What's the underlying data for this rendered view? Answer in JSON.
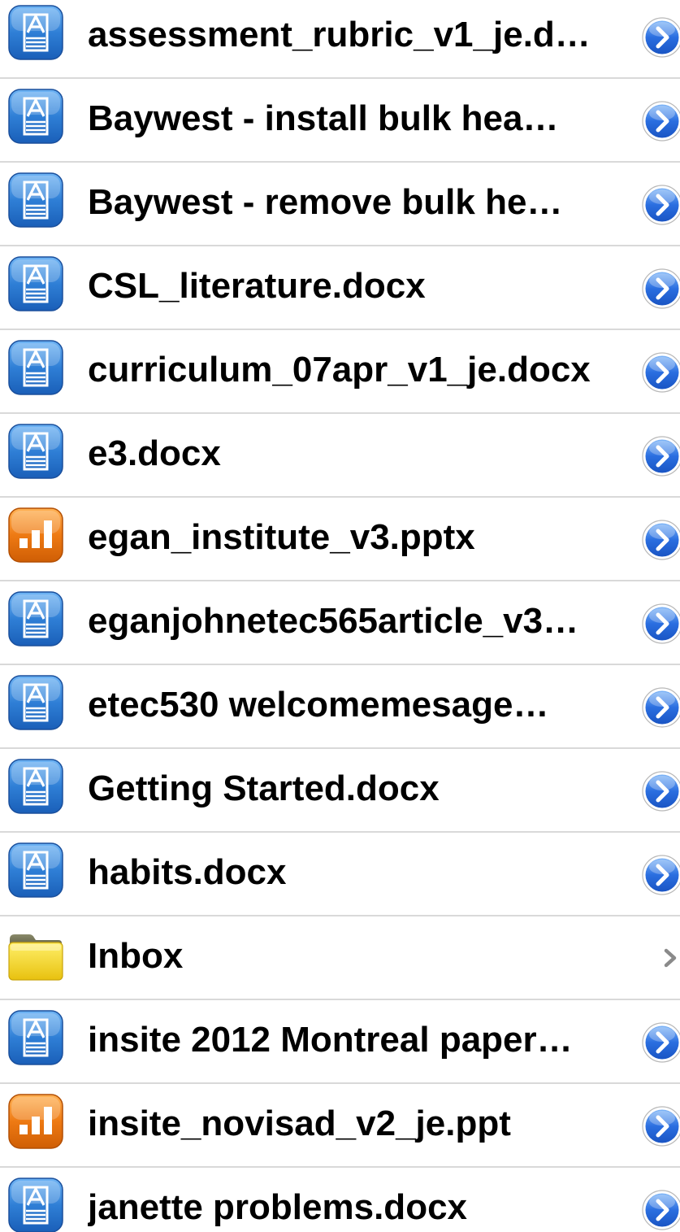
{
  "files": [
    {
      "name": "assessment_rubric_v1_je.d…",
      "type": "doc",
      "accessory": "detail"
    },
    {
      "name": "Baywest - install bulk hea…",
      "type": "doc",
      "accessory": "detail"
    },
    {
      "name": "Baywest - remove bulk he…",
      "type": "doc",
      "accessory": "detail"
    },
    {
      "name": "CSL_literature.docx",
      "type": "doc",
      "accessory": "detail"
    },
    {
      "name": "curriculum_07apr_v1_je.docx",
      "type": "doc",
      "accessory": "detail"
    },
    {
      "name": "e3.docx",
      "type": "doc",
      "accessory": "detail"
    },
    {
      "name": "egan_institute_v3.pptx",
      "type": "ppt",
      "accessory": "detail"
    },
    {
      "name": "eganjohnetec565article_v3…",
      "type": "doc",
      "accessory": "detail"
    },
    {
      "name": "etec530 welcomemesage…",
      "type": "doc",
      "accessory": "detail"
    },
    {
      "name": "Getting Started.docx",
      "type": "doc",
      "accessory": "detail"
    },
    {
      "name": "habits.docx",
      "type": "doc",
      "accessory": "detail"
    },
    {
      "name": "Inbox",
      "type": "folder",
      "accessory": "chevron"
    },
    {
      "name": "insite 2012 Montreal paper…",
      "type": "doc",
      "accessory": "detail"
    },
    {
      "name": "insite_novisad_v2_je.ppt",
      "type": "ppt",
      "accessory": "detail"
    },
    {
      "name": "janette problems.docx",
      "type": "doc",
      "accessory": "detail"
    }
  ],
  "colors": {
    "doc_icon": "#2f7fd6",
    "ppt_icon": "#ee7a13",
    "folder_icon": "#f3cf1f",
    "detail_button": "#2a6ee0",
    "separator": "#d9d9d9",
    "chevron": "#8a8a8a"
  },
  "icons": {
    "doc": "word-document-icon",
    "ppt": "presentation-icon",
    "folder": "folder-icon",
    "detail": "detail-disclosure-icon",
    "chevron": "chevron-right-icon"
  }
}
